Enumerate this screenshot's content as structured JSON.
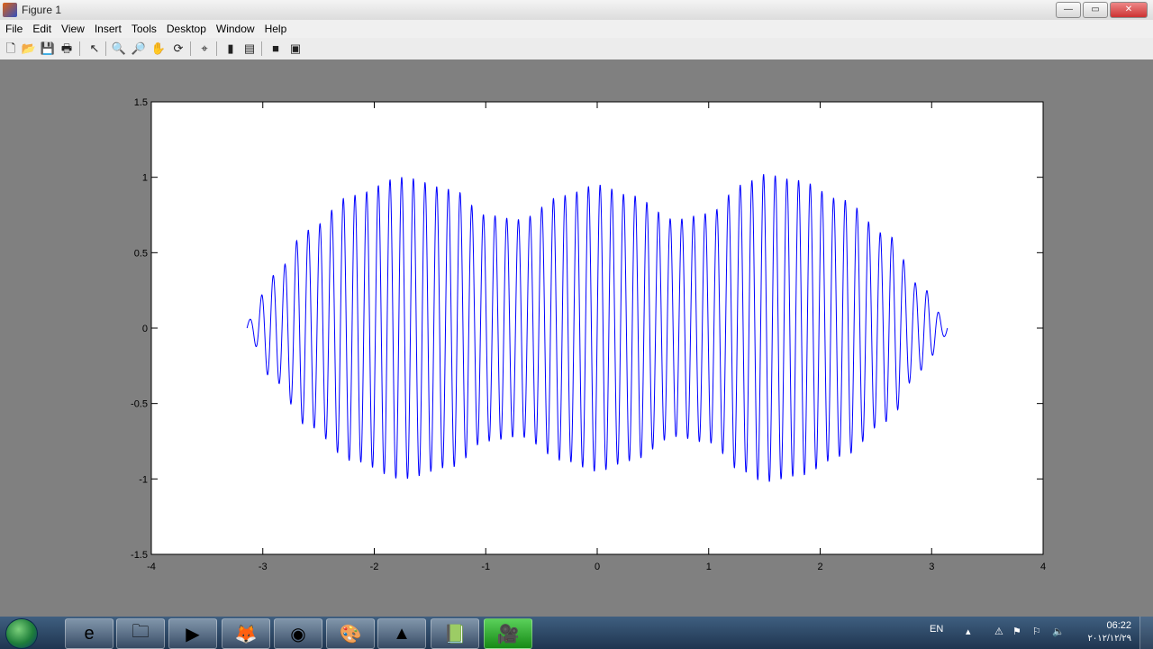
{
  "window": {
    "title": "Figure 1",
    "buttons": [
      "minimize",
      "maximize",
      "close"
    ]
  },
  "menu": [
    "File",
    "Edit",
    "View",
    "Insert",
    "Tools",
    "Desktop",
    "Window",
    "Help"
  ],
  "toolbar": [
    {
      "name": "new-figure-icon",
      "glyph": "🗋"
    },
    {
      "name": "open-file-icon",
      "glyph": "📂"
    },
    {
      "name": "save-icon",
      "glyph": "💾"
    },
    {
      "name": "print-icon",
      "glyph": "🖶"
    },
    {
      "name": "select-arrow-icon",
      "glyph": "↖"
    },
    {
      "name": "zoom-in-icon",
      "glyph": "🔍"
    },
    {
      "name": "zoom-out-icon",
      "glyph": "🔎"
    },
    {
      "name": "pan-hand-icon",
      "glyph": "✋"
    },
    {
      "name": "rotate-3d-icon",
      "glyph": "⟳"
    },
    {
      "name": "data-cursor-icon",
      "glyph": "⌖"
    },
    {
      "name": "insert-colorbar-icon",
      "glyph": "▮"
    },
    {
      "name": "insert-legend-icon",
      "glyph": "▤"
    },
    {
      "name": "hide-plot-tools-icon",
      "glyph": "■"
    },
    {
      "name": "show-plot-tools-icon",
      "glyph": "▣"
    }
  ],
  "chart_data": {
    "type": "line",
    "title": "",
    "xlabel": "",
    "ylabel": "",
    "xlim": [
      -4,
      4
    ],
    "ylim": [
      -1.5,
      1.5
    ],
    "xticks": [
      "-4",
      "-3",
      "-2",
      "-1",
      "0",
      "1",
      "2",
      "3",
      "4"
    ],
    "yticks": [
      "-1.5",
      "-1",
      "-0.5",
      "0",
      "0.5",
      "1",
      "1.5"
    ],
    "series": [
      {
        "color": "#0000ff",
        "domain": [
          -3.14159,
          3.14159
        ],
        "samples": 3000,
        "expression": "y = sin(50*x) * sin(x)^2 ... approx envelope (0.85|sin(x)| + 0.15) — oscillation ~50 cycles per 2π",
        "envelope_points": [
          [
            -3.14,
            0.05
          ],
          [
            -2.9,
            0.35
          ],
          [
            -2.6,
            0.65
          ],
          [
            -2.2,
            0.88
          ],
          [
            -1.75,
            1.0
          ],
          [
            -1.3,
            0.92
          ],
          [
            -1.0,
            0.75
          ],
          [
            -0.7,
            0.72
          ],
          [
            -0.3,
            0.88
          ],
          [
            0.0,
            0.95
          ],
          [
            0.3,
            0.88
          ],
          [
            0.7,
            0.72
          ],
          [
            1.0,
            0.76
          ],
          [
            1.3,
            0.95
          ],
          [
            1.5,
            1.02
          ],
          [
            1.8,
            0.98
          ],
          [
            2.2,
            0.85
          ],
          [
            2.6,
            0.62
          ],
          [
            2.9,
            0.28
          ],
          [
            3.14,
            0.05
          ]
        ],
        "cycles": 60
      }
    ],
    "grid": false,
    "legend": null
  },
  "taskbar": {
    "apps": [
      {
        "name": "ie-taskbar-icon",
        "glyph": "e"
      },
      {
        "name": "explorer-taskbar-icon",
        "glyph": "🗀"
      },
      {
        "name": "media-player-taskbar-icon",
        "glyph": "▶"
      },
      {
        "name": "firefox-taskbar-icon",
        "glyph": "🦊"
      },
      {
        "name": "chrome-taskbar-icon",
        "glyph": "◉"
      },
      {
        "name": "paint-taskbar-icon",
        "glyph": "🎨"
      },
      {
        "name": "matlab-taskbar-icon",
        "glyph": "▲"
      },
      {
        "name": "notes-taskbar-icon",
        "glyph": "📗"
      },
      {
        "name": "camera-taskbar-icon",
        "glyph": "🎥"
      }
    ],
    "language": "EN",
    "time": "06:22",
    "date": "۲۰۱۲/۱۲/۲۹"
  }
}
